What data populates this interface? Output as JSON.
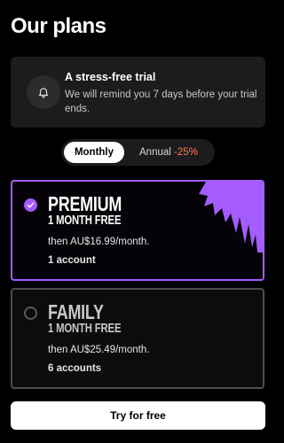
{
  "page": {
    "title": "Our plans"
  },
  "trial": {
    "icon": "bell-icon",
    "heading": "A stress-free trial",
    "text": "We will remind you 7 days before your trial ends."
  },
  "billing_toggle": {
    "monthly_label": "Monthly",
    "annual_label": "Annual",
    "annual_discount": "-25%",
    "selected": "Monthly"
  },
  "plans": [
    {
      "name": "PREMIUM",
      "offer": "1 MONTH FREE",
      "price": "then AU$16.99/month.",
      "accounts": "1 account",
      "selected": true,
      "accent": "#a45cff"
    },
    {
      "name": "FAMILY",
      "offer": "1 MONTH FREE",
      "price": "then AU$25.49/month.",
      "accounts": "6 accounts",
      "selected": false
    }
  ],
  "cta": {
    "label": "Try for free"
  }
}
